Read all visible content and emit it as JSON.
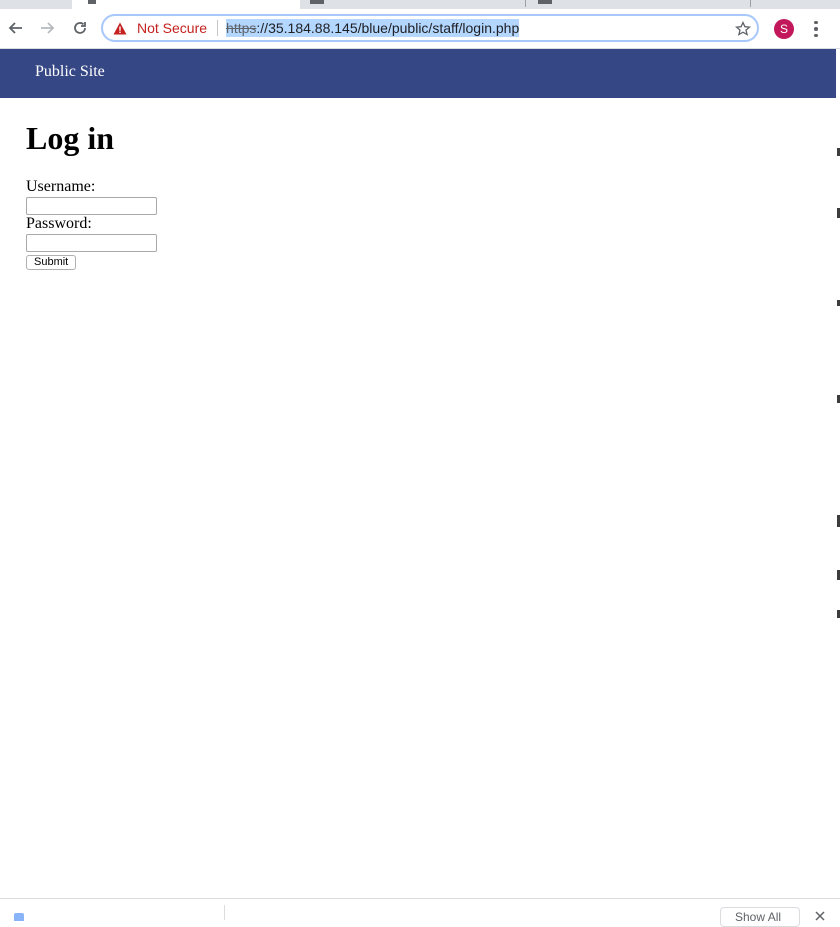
{
  "browser": {
    "security_label": "Not Secure",
    "url_scheme": "https",
    "url_rest": "://35.184.88.145/blue/public/staff/login.php",
    "profile_initial": "S",
    "icons": [
      "back-icon",
      "forward-icon",
      "reload-icon",
      "warning-icon",
      "star-icon",
      "menu-icon"
    ]
  },
  "site": {
    "nav_link": "Public Site",
    "header_color": "#364785"
  },
  "login": {
    "title": "Log in",
    "username_label": "Username:",
    "username_value": "",
    "password_label": "Password:",
    "password_value": "",
    "submit_label": "Submit"
  },
  "downloads": {
    "show_all_label": "Show All"
  }
}
